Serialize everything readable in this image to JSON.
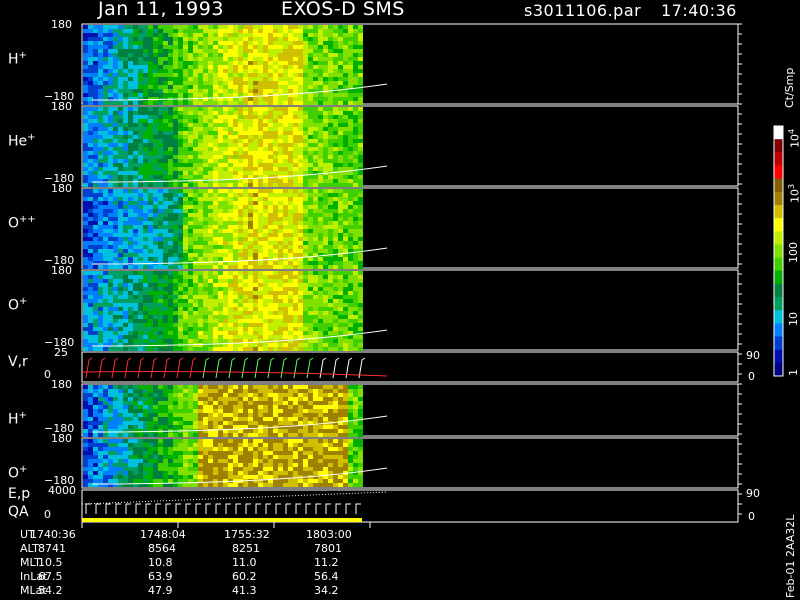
{
  "header": {
    "date": "Jan 11, 1993",
    "instrument": "EXOS-D SMS",
    "file": "s3011106.par",
    "time": "17:40:36"
  },
  "colorbar": {
    "title": "Ct/Smp",
    "tick_labels": [
      "1",
      "10",
      "100",
      "10",
      "10"
    ],
    "tick_exponents": [
      "",
      "",
      "",
      "3",
      "4"
    ],
    "colors": [
      "#000080",
      "#0010b0",
      "#0040d0",
      "#0080ff",
      "#00c0e0",
      "#00a060",
      "#008040",
      "#00b000",
      "#40d000",
      "#80e000",
      "#c0f000",
      "#ffff00",
      "#d0c000",
      "#a08000",
      "#806000",
      "#ff0000",
      "#c00000",
      "#800000",
      "#ffffff"
    ]
  },
  "footer_rotated": "Feb-01 2AA32L",
  "panels": [
    {
      "id": "h-plus",
      "label": "H",
      "sup": "+",
      "y_top": "180",
      "y_bottom": "−180"
    },
    {
      "id": "he-plus",
      "label": "He",
      "sup": "+",
      "y_top": "180",
      "y_bottom": "−180"
    },
    {
      "id": "o-plusplus",
      "label": "O",
      "sup": "++",
      "y_top": "180",
      "y_bottom": "−180"
    },
    {
      "id": "o-plus",
      "label": "O",
      "sup": "+",
      "y_top": "180",
      "y_bottom": "−180"
    },
    {
      "id": "vr",
      "label": "V,r",
      "sup": "",
      "y_top": "25",
      "y_bottom": "0",
      "right_top": "90",
      "right_bottom": "0"
    },
    {
      "id": "h-plus-2",
      "label": "H",
      "sup": "+",
      "y_top": "180",
      "y_bottom": "−180"
    },
    {
      "id": "o-plus-2",
      "label": "O",
      "sup": "+",
      "y_top": "180",
      "y_bottom": "−180"
    },
    {
      "id": "ep-qa",
      "label": "E,p",
      "label2": "QA",
      "sup": "",
      "y_top": "4000",
      "y_bottom": "0",
      "right_top": "90",
      "right_bottom": "0"
    }
  ],
  "orbit_table": {
    "row_labels": [
      "UT",
      "ALT",
      "MLT",
      "InLat",
      "MLat"
    ],
    "columns": [
      [
        "1740:36",
        "8741",
        "10.5",
        "67.5",
        "54.2"
      ],
      [
        "1748:04",
        "8564",
        "10.8",
        "63.9",
        "47.9"
      ],
      [
        "1755:32",
        "8251",
        "11.0",
        "60.2",
        "41.3"
      ],
      [
        "1803:00",
        "7801",
        "11.2",
        "56.4",
        "34.2"
      ]
    ]
  },
  "chart_data": {
    "type": "heatmap",
    "title": "Jan 11, 1993   EXOS-D SMS",
    "x_ticks": [
      "1740:36",
      "1748:04",
      "1755:32",
      "1803:00"
    ],
    "color_scale": "log",
    "color_label": "Ct/Smp",
    "color_range": [
      1,
      10000
    ],
    "panels": [
      "H+",
      "He+",
      "O++",
      "O+",
      "V,r",
      "H+",
      "O+",
      "E,p QA"
    ],
    "ylim_spectrogram": [
      -180,
      180
    ],
    "ylim_vr": [
      0,
      25
    ],
    "ylim_ep": [
      0,
      4000
    ]
  }
}
